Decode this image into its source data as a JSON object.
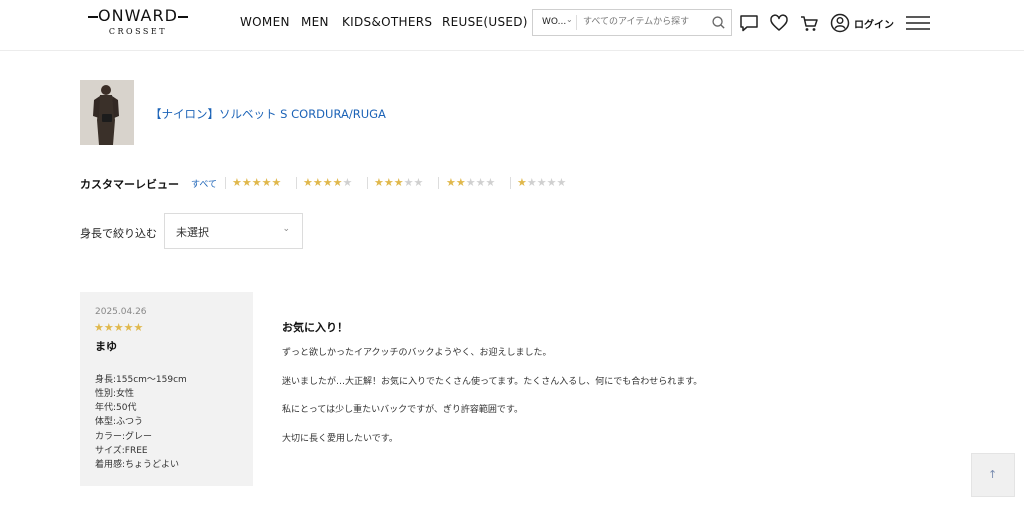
{
  "brand": {
    "name": "ONWARD",
    "sub": "CROSSET"
  },
  "nav": [
    "WOMEN",
    "MEN",
    "KIDS&OTHERS",
    "REUSE(USED)"
  ],
  "search": {
    "category": "WO...",
    "placeholder": "すべてのアイテムから探す"
  },
  "header_icons": [
    "chat-icon",
    "heart-icon",
    "cart-icon",
    "user-icon",
    "menu-icon"
  ],
  "login_label": "ログイン",
  "product": {
    "title": "【ナイロン】ソルベット S CORDURA/RUGA"
  },
  "reviews": {
    "label": "カスタマーレビュー",
    "all_link": "すべて",
    "star_filters": [
      5,
      4,
      3,
      2,
      1
    ],
    "height_filter_label": "身長で絞り込む",
    "height_select_value": "未選択"
  },
  "review": {
    "date": "2025.04.26",
    "rating": 5,
    "name": "まゆ",
    "attributes": [
      "身長:155cm〜159cm",
      "性別:女性",
      "年代:50代",
      "体型:ふつう",
      "カラー:グレー",
      "サイズ:FREE",
      "着用感:ちょうどよい"
    ],
    "title": "お気に入り！",
    "paragraphs": [
      "ずっと欲しかったイアクッチのバックようやく、お迎えしました。",
      "迷いましたが…大正解！お気に入りでたくさん使ってます。たくさん入るし、何にでも合わせられます。",
      "私にとっては少し重たいバックですが、ぎり許容範囲です。",
      "大切に長く愛用したいです。"
    ]
  },
  "colors": {
    "link": "#1c63b7",
    "star": "#e0b84c",
    "star_off": "#d0d0d0",
    "card_bg": "#f2f2f2"
  }
}
